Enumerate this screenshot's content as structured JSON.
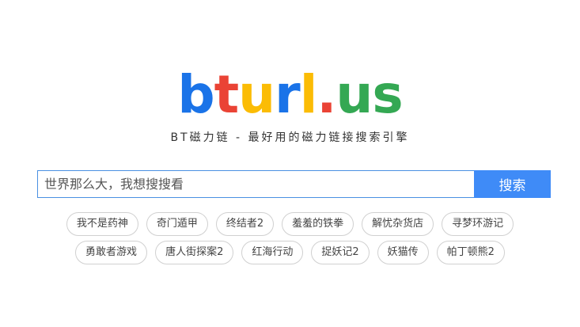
{
  "logo": {
    "letters": [
      {
        "char": "b",
        "color": "#1a73e8"
      },
      {
        "char": "t",
        "color": "#ea4335"
      },
      {
        "char": "u",
        "color": "#fbbc05"
      },
      {
        "char": "r",
        "color": "#1a73e8"
      },
      {
        "char": "l",
        "color": "#fbbc05"
      },
      {
        "char": ".",
        "color": "#ea4335"
      },
      {
        "char": "u",
        "color": "#34a853"
      },
      {
        "char": "s",
        "color": "#34a853"
      }
    ]
  },
  "tagline": "BT磁力链 - 最好用的磁力链接搜索引擎",
  "search": {
    "value": "",
    "placeholder": "世界那么大，我想搜搜看",
    "button_label": "搜索"
  },
  "hot_tags": {
    "row1": [
      {
        "label": "我不是药神"
      },
      {
        "label": "奇门遁甲"
      },
      {
        "label": "终结者2"
      },
      {
        "label": "羞羞的铁拳"
      },
      {
        "label": "解忧杂货店"
      },
      {
        "label": "寻梦环游记"
      }
    ],
    "row2": [
      {
        "label": "勇敢者游戏"
      },
      {
        "label": "唐人街探案2"
      },
      {
        "label": "红海行动"
      },
      {
        "label": "捉妖记2"
      },
      {
        "label": "妖猫传"
      },
      {
        "label": "帕丁顿熊2"
      }
    ]
  },
  "colors": {
    "accent": "#3f8bf7",
    "input_border": "#4a90e2",
    "tag_border": "#d0d0d0"
  }
}
